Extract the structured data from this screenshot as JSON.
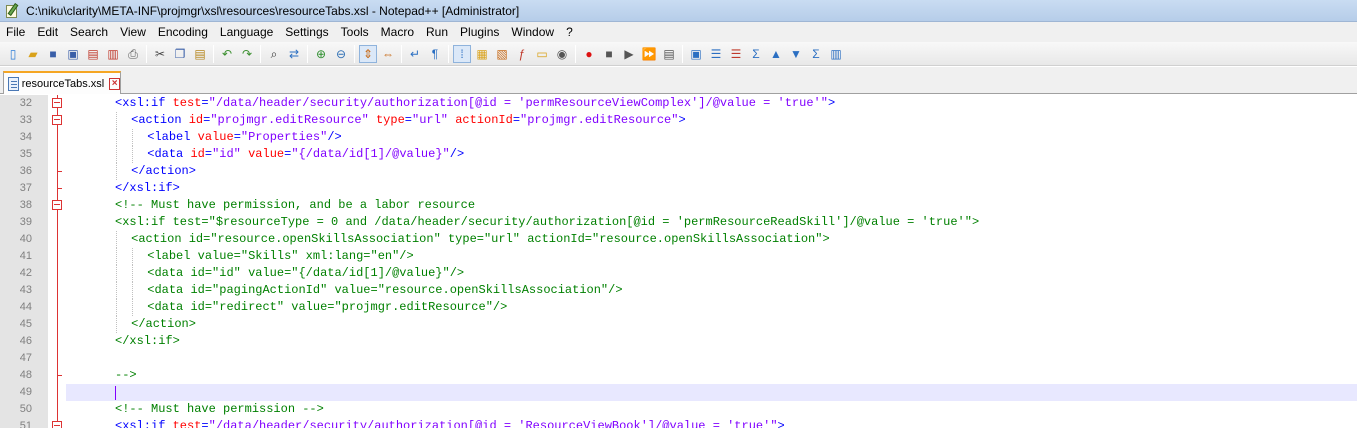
{
  "window": {
    "title": "C:\\niku\\clarity\\META-INF\\projmgr\\xsl\\resources\\resourceTabs.xsl - Notepad++ [Administrator]"
  },
  "menu": {
    "items": [
      "File",
      "Edit",
      "Search",
      "View",
      "Encoding",
      "Language",
      "Settings",
      "Tools",
      "Macro",
      "Run",
      "Plugins",
      "Window",
      "?"
    ]
  },
  "tab": {
    "label": "resourceTabs.xsl",
    "close_symbol": "×"
  },
  "colors": {
    "tag": "#0000ff",
    "attribute": "#ff0000",
    "value": "#8000ff",
    "comment": "#008000",
    "fold_marker": "#dd3333",
    "current_line": "#e8e8ff"
  },
  "editor": {
    "lines": [
      {
        "num": "32",
        "fold": "box",
        "indent": 0,
        "segments": [
          {
            "t": "tag",
            "v": "<xsl:if "
          },
          {
            "t": "attr",
            "v": "test"
          },
          {
            "t": "tag",
            "v": "="
          },
          {
            "t": "val",
            "v": "\"/data/header/security/authorization[@id = 'permResourceViewComplex']/@value = 'true'\""
          },
          {
            "t": "tag",
            "v": ">"
          }
        ]
      },
      {
        "num": "33",
        "fold": "box",
        "indent": 1,
        "segments": [
          {
            "t": "tag",
            "v": "<action "
          },
          {
            "t": "attr",
            "v": "id"
          },
          {
            "t": "tag",
            "v": "="
          },
          {
            "t": "val",
            "v": "\"projmgr.editResource\""
          },
          {
            "t": "tag",
            "v": " "
          },
          {
            "t": "attr",
            "v": "type"
          },
          {
            "t": "tag",
            "v": "="
          },
          {
            "t": "val",
            "v": "\"url\""
          },
          {
            "t": "tag",
            "v": " "
          },
          {
            "t": "attr",
            "v": "actionId"
          },
          {
            "t": "tag",
            "v": "="
          },
          {
            "t": "val",
            "v": "\"projmgr.editResource\""
          },
          {
            "t": "tag",
            "v": ">"
          }
        ]
      },
      {
        "num": "34",
        "fold": "line",
        "indent": 2,
        "segments": [
          {
            "t": "tag",
            "v": "<label "
          },
          {
            "t": "attr",
            "v": "value"
          },
          {
            "t": "tag",
            "v": "="
          },
          {
            "t": "val",
            "v": "\"Properties\""
          },
          {
            "t": "tag",
            "v": "/>"
          }
        ]
      },
      {
        "num": "35",
        "fold": "line",
        "indent": 2,
        "segments": [
          {
            "t": "tag",
            "v": "<data "
          },
          {
            "t": "attr",
            "v": "id"
          },
          {
            "t": "tag",
            "v": "="
          },
          {
            "t": "val",
            "v": "\"id\""
          },
          {
            "t": "tag",
            "v": " "
          },
          {
            "t": "attr",
            "v": "value"
          },
          {
            "t": "tag",
            "v": "="
          },
          {
            "t": "val",
            "v": "\"{/data/id[1]/@value}\""
          },
          {
            "t": "tag",
            "v": "/>"
          }
        ]
      },
      {
        "num": "36",
        "fold": "end",
        "indent": 1,
        "segments": [
          {
            "t": "tag",
            "v": "</action>"
          }
        ]
      },
      {
        "num": "37",
        "fold": "end",
        "indent": 0,
        "segments": [
          {
            "t": "tag",
            "v": "</xsl:if>"
          }
        ]
      },
      {
        "num": "38",
        "fold": "box",
        "indent": 0,
        "segments": [
          {
            "t": "cmt",
            "v": "<!-- Must have permission, and be a labor resource"
          }
        ]
      },
      {
        "num": "39",
        "fold": "line",
        "indent": 0,
        "segments": [
          {
            "t": "cmt",
            "v": "<xsl:if test=\"$resourceType = 0 and /data/header/security/authorization[@id = 'permResourceReadSkill']/@value = 'true'\">"
          }
        ]
      },
      {
        "num": "40",
        "fold": "line",
        "indent": 1,
        "segments": [
          {
            "t": "cmt",
            "v": "<action id=\"resource.openSkillsAssociation\" type=\"url\" actionId=\"resource.openSkillsAssociation\">"
          }
        ]
      },
      {
        "num": "41",
        "fold": "line",
        "indent": 2,
        "segments": [
          {
            "t": "cmt",
            "v": "<label value=\"Skills\" xml:lang=\"en\"/>"
          }
        ]
      },
      {
        "num": "42",
        "fold": "line",
        "indent": 2,
        "segments": [
          {
            "t": "cmt",
            "v": "<data id=\"id\" value=\"{/data/id[1]/@value}\"/>"
          }
        ]
      },
      {
        "num": "43",
        "fold": "line",
        "indent": 2,
        "segments": [
          {
            "t": "cmt",
            "v": "<data id=\"pagingActionId\" value=\"resource.openSkillsAssociation\"/>"
          }
        ]
      },
      {
        "num": "44",
        "fold": "line",
        "indent": 2,
        "segments": [
          {
            "t": "cmt",
            "v": "<data id=\"redirect\" value=\"projmgr.editResource\"/>"
          }
        ]
      },
      {
        "num": "45",
        "fold": "line",
        "indent": 1,
        "segments": [
          {
            "t": "cmt",
            "v": "</action>"
          }
        ]
      },
      {
        "num": "46",
        "fold": "line",
        "indent": 0,
        "segments": [
          {
            "t": "cmt",
            "v": "</xsl:if>"
          }
        ]
      },
      {
        "num": "47",
        "fold": "line",
        "indent": 0,
        "segments": []
      },
      {
        "num": "48",
        "fold": "end",
        "indent": 0,
        "segments": [
          {
            "t": "cmt",
            "v": "-->"
          }
        ]
      },
      {
        "num": "49",
        "fold": "none",
        "indent": 0,
        "current": true,
        "segments": []
      },
      {
        "num": "50",
        "fold": "none",
        "indent": 0,
        "segments": [
          {
            "t": "cmt",
            "v": "<!-- Must have permission -->"
          }
        ]
      },
      {
        "num": "51",
        "fold": "box",
        "indent": 0,
        "segments": [
          {
            "t": "tag",
            "v": "<xsl:if "
          },
          {
            "t": "attr",
            "v": "test"
          },
          {
            "t": "tag",
            "v": "="
          },
          {
            "t": "val",
            "v": "\"/data/header/security/authorization[@id = 'ResourceViewBook']/@value = 'true'\""
          },
          {
            "t": "tag",
            "v": ">"
          }
        ]
      }
    ]
  },
  "toolbar": {
    "icons": [
      "new-file-icon",
      "open-file-icon",
      "save-icon",
      "save-all-icon",
      "close-icon",
      "close-all-icon",
      "print-icon",
      "sep",
      "cut-icon",
      "copy-icon",
      "paste-icon",
      "sep",
      "undo-icon",
      "redo-icon",
      "sep",
      "find-icon",
      "replace-icon",
      "sep",
      "zoom-in-icon",
      "zoom-out-icon",
      "sep",
      "sync-vertical-icon",
      "sync-horizontal-icon",
      "sep",
      "word-wrap-icon",
      "show-all-chars-icon",
      "sep",
      "indent-guide-icon",
      "user-lang-icon",
      "doc-map-icon",
      "function-list-icon",
      "folder-workspace-icon",
      "monitor-icon",
      "sep",
      "record-macro-icon",
      "stop-record-icon",
      "play-macro-icon",
      "run-macro-multiple-icon",
      "save-macro-icon",
      "sep",
      "plugin-a-icon",
      "plugin-b-icon",
      "plugin-c-icon",
      "plugin-d-icon",
      "arrow-up-icon",
      "arrow-down-icon",
      "plugin-e-icon",
      "plugin-f-icon"
    ]
  }
}
